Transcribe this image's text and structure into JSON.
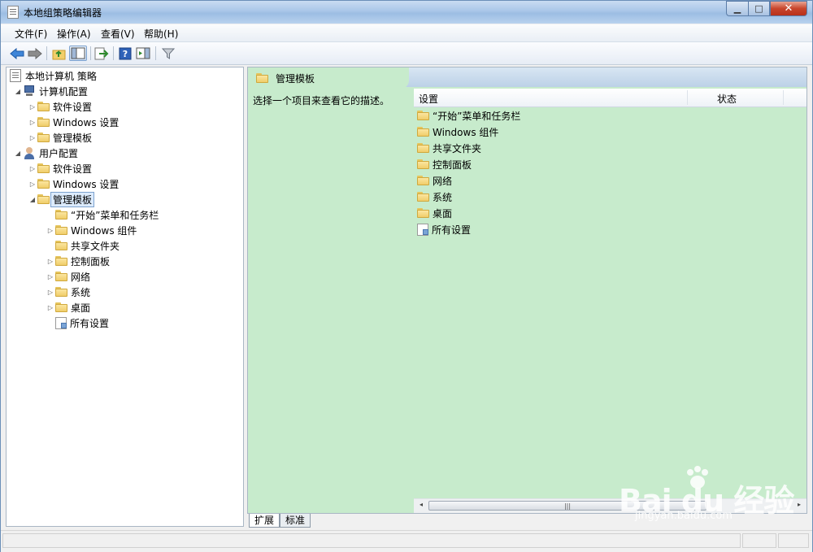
{
  "window": {
    "title": "本地组策略编辑器",
    "controls": {
      "minimize": "▁",
      "maximize": "□",
      "close": "✕"
    }
  },
  "menubar": {
    "items": [
      "文件(F)",
      "操作(A)",
      "查看(V)",
      "帮助(H)"
    ]
  },
  "toolbar": {
    "buttons": [
      "back-icon",
      "forward-icon",
      "up-folder-icon",
      "show-hide-tree-icon",
      "export-list-icon",
      "help-icon",
      "action-pane-icon",
      "filter-icon"
    ]
  },
  "tree": {
    "root": "本地计算机 策略",
    "computer_config": "计算机配置",
    "user_config": "用户配置",
    "software_settings": "软件设置",
    "windows_settings": "Windows 设置",
    "admin_templates": "管理模板",
    "children": [
      "“开始”菜单和任务栏",
      "Windows 组件",
      "共享文件夹",
      "控制面板",
      "网络",
      "系统",
      "桌面",
      "所有设置"
    ]
  },
  "right_pane": {
    "header_title": "管理模板",
    "description": "选择一个项目来查看它的描述。",
    "columns": {
      "setting": "设置",
      "state": "状态"
    },
    "items": [
      "“开始”菜单和任务栏",
      "Windows 组件",
      "共享文件夹",
      "控制面板",
      "网络",
      "系统",
      "桌面",
      "所有设置"
    ]
  },
  "tabs": {
    "extended": "扩展",
    "standard": "标准"
  },
  "scroll": {
    "left": "◂",
    "right": "▸",
    "grip": "|||"
  },
  "tree_glyphs": {
    "collapsed": "▷",
    "expanded": "◢"
  },
  "watermark": {
    "logo": "Bai du 经验",
    "url": "jingyan.baidu.com"
  }
}
